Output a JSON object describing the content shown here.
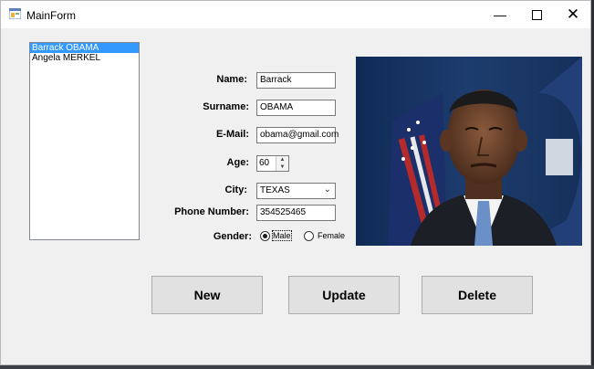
{
  "window": {
    "title": "MainForm"
  },
  "list": {
    "items": [
      "Barrack OBAMA",
      "Angela MERKEL"
    ],
    "selected_index": 0
  },
  "form": {
    "name_label": "Name:",
    "name_value": "Barrack",
    "surname_label": "Surname:",
    "surname_value": "OBAMA",
    "email_label": "E-Mail:",
    "email_value": "obama@gmail.com",
    "age_label": "Age:",
    "age_value": "60",
    "city_label": "City:",
    "city_value": "TEXAS",
    "phone_label": "Phone Number:",
    "phone_value": "354525465",
    "gender_label": "Gender:",
    "gender_options": [
      "Male",
      "Female"
    ],
    "gender_selected": "Male"
  },
  "buttons": {
    "new": "New",
    "update": "Update",
    "delete": "Delete"
  },
  "colors": {
    "selection": "#3399ff",
    "window_bg": "#f0f0f0",
    "button_bg": "#e1e1e1"
  }
}
